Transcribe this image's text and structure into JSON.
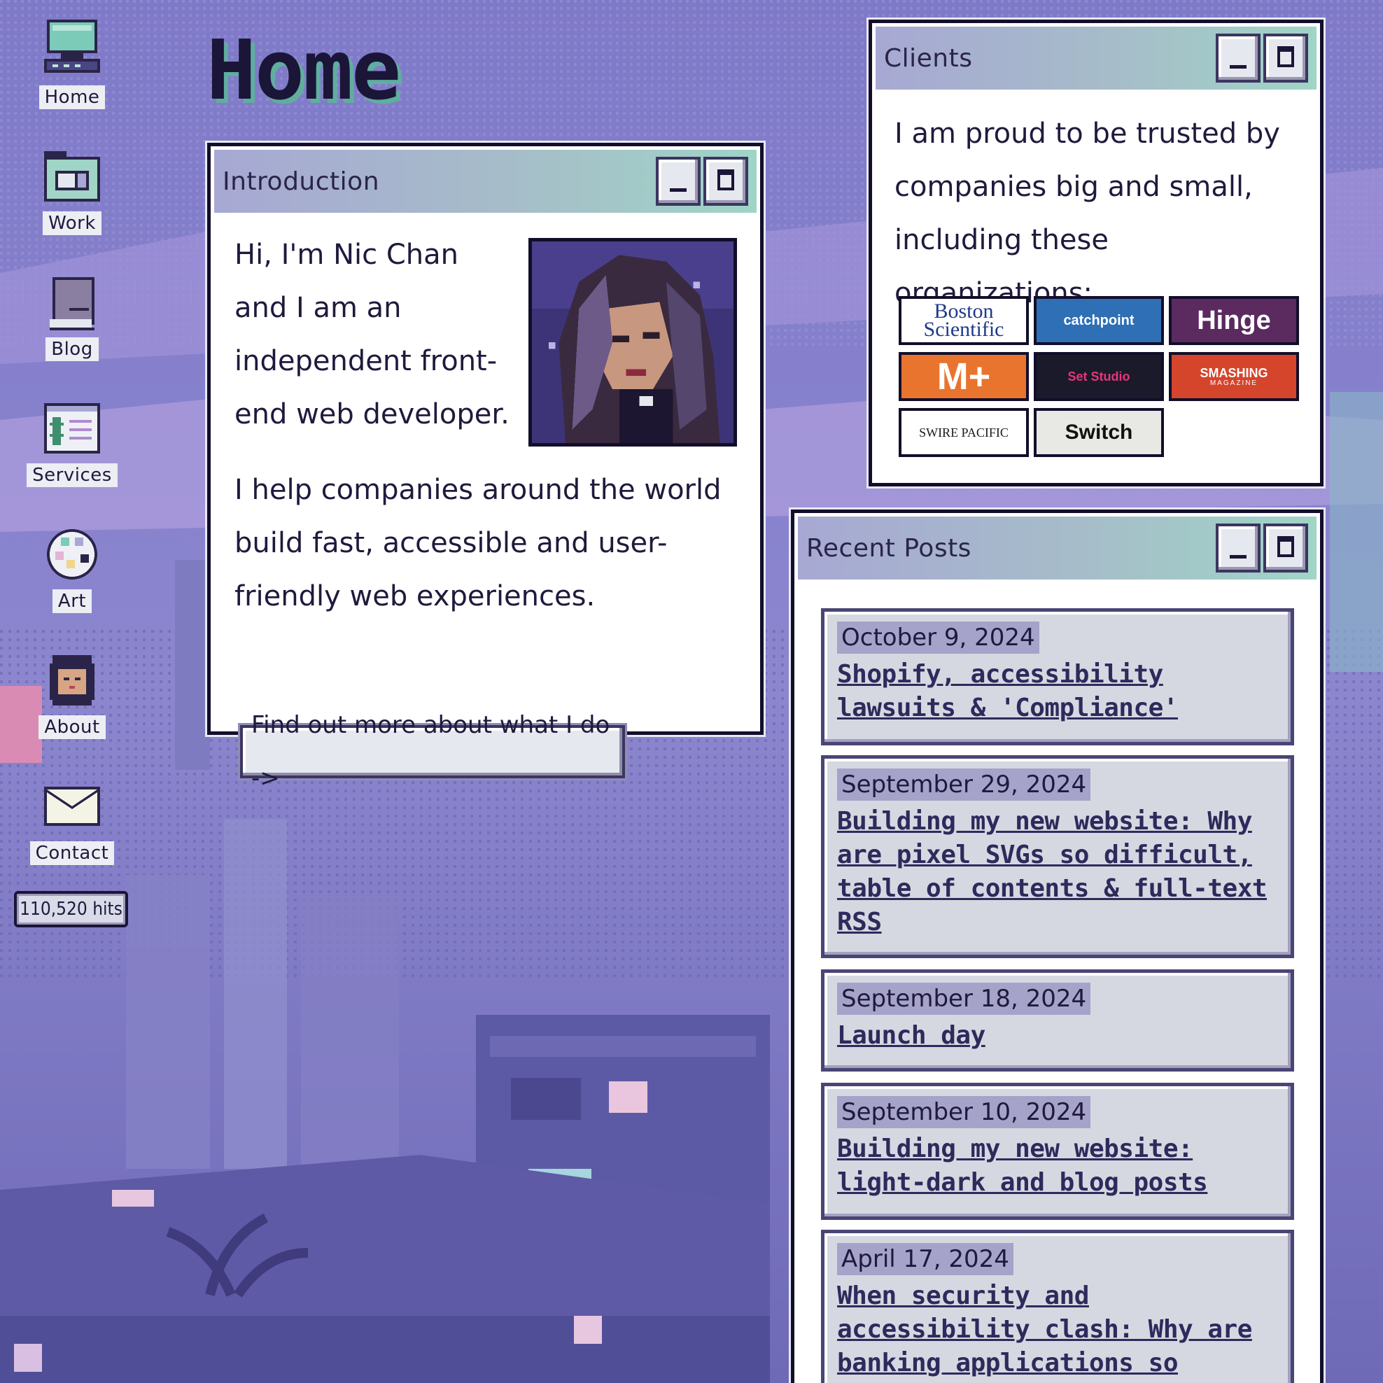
{
  "page": {
    "title": "Home"
  },
  "sidebar": {
    "items": [
      {
        "label": "Home",
        "icon": "computer-icon"
      },
      {
        "label": "Work",
        "icon": "folder-icon"
      },
      {
        "label": "Blog",
        "icon": "notebook-icon"
      },
      {
        "label": "Services",
        "icon": "price-list-icon"
      },
      {
        "label": "Art",
        "icon": "paint-palette-icon"
      },
      {
        "label": "About",
        "icon": "avatar-icon"
      },
      {
        "label": "Contact",
        "icon": "envelope-icon"
      }
    ],
    "hits": "110,520 hits"
  },
  "intro": {
    "title": "Introduction",
    "p1": "Hi, I'm Nic Chan and I am an independent front-end web developer.",
    "p2": "I help companies around the world build fast, accessible and user-friendly web experiences.",
    "cta": "Find out more about what I do ->"
  },
  "clients": {
    "title": "Clients",
    "text": "I am proud to be trusted by companies big and small, including these organizations:",
    "logos": [
      {
        "name": "Boston Scientific",
        "bg": "#ffffff",
        "fg": "#1e3a8a"
      },
      {
        "name": "catchpoint",
        "bg": "#2e6fb5",
        "fg": "#ffffff"
      },
      {
        "name": "Hinge",
        "bg": "#5b2a5f",
        "fg": "#ffffff"
      },
      {
        "name": "M+",
        "bg": "#e9742e",
        "fg": "#ffffff"
      },
      {
        "name": "Set Studio",
        "bg": "#1a1a2a",
        "fg": "#e8357a"
      },
      {
        "name": "SMASHING",
        "sub": "MAGAZINE",
        "bg": "#d4452c",
        "fg": "#ffffff"
      },
      {
        "name": "SWIRE PACIFIC",
        "bg": "#ffffff",
        "fg": "#1a1a1a"
      },
      {
        "name": "Switch",
        "bg": "#e8e8e4",
        "fg": "#111111"
      }
    ]
  },
  "posts": {
    "title": "Recent Posts",
    "items": [
      {
        "date": "October 9, 2024",
        "title": "Shopify, accessibility lawsuits & 'Compliance'"
      },
      {
        "date": "September 29, 2024",
        "title": "Building my new website: Why are pixel SVGs so difficult, table of contents & full-text RSS"
      },
      {
        "date": "September 18, 2024",
        "title": "Launch day"
      },
      {
        "date": "September 10, 2024",
        "title": "Building my new website: light-dark and blog posts"
      },
      {
        "date": "April 17, 2024",
        "title": "When security and accessibility clash: Why are banking applications so"
      }
    ]
  },
  "colors": {
    "accent": "#5fae9f",
    "window_border": "#120e2a",
    "title_gradient_start": "#a7a8d3",
    "title_gradient_end": "#9fd4c6"
  }
}
